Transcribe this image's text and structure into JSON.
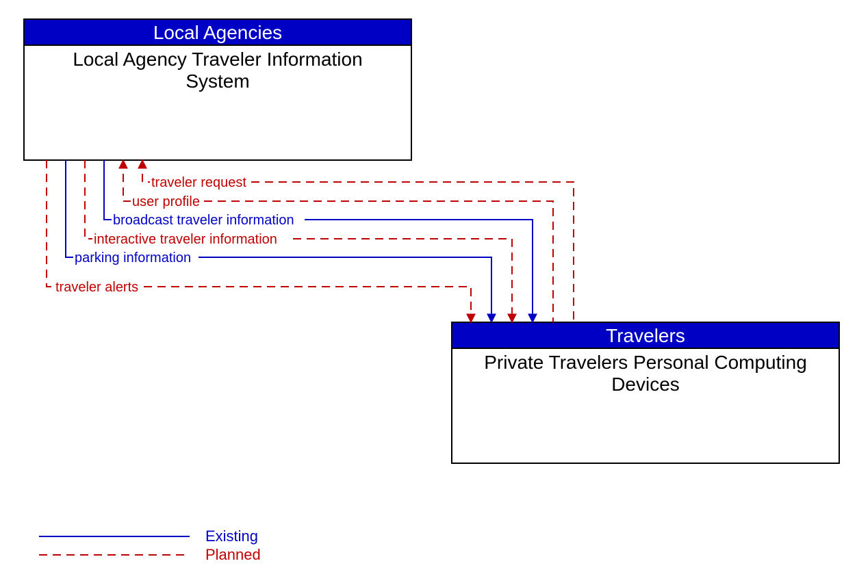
{
  "boxes": {
    "top": {
      "header": "Local Agencies",
      "line1": "Local Agency Traveler Information",
      "line2": "System"
    },
    "bottom": {
      "header": "Travelers",
      "line1": "Private Travelers Personal Computing",
      "line2": "Devices"
    }
  },
  "flows": {
    "f1": "traveler request",
    "f2": "user profile",
    "f3": "broadcast traveler information",
    "f4": "interactive traveler information",
    "f5": "parking information",
    "f6": "traveler alerts"
  },
  "legend": {
    "existing": "Existing",
    "planned": "Planned"
  },
  "colors": {
    "header_bg": "#0000c4",
    "existing": "#0000c4",
    "planned": "#c00000",
    "border": "#000000"
  }
}
